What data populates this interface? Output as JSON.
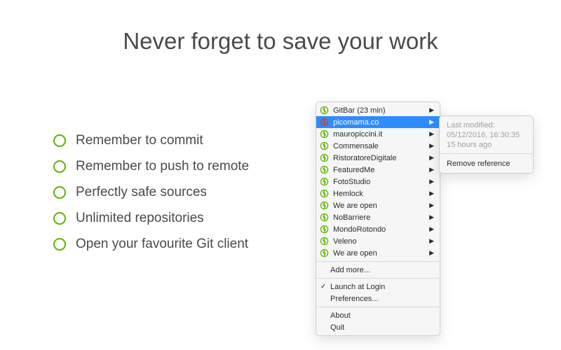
{
  "headline": "Never forget to save your work",
  "features": [
    "Remember to commit",
    "Remember to push to remote",
    "Perfectly safe sources",
    "Unlimited repositories",
    "Open your favourite Git client"
  ],
  "menu": {
    "repos": [
      {
        "name": "GitBar (23 min)",
        "status": "green",
        "selected": false
      },
      {
        "name": "picomama.co",
        "status": "red",
        "selected": true
      },
      {
        "name": "mauropiccini.it",
        "status": "green",
        "selected": false
      },
      {
        "name": "Commensale",
        "status": "green",
        "selected": false
      },
      {
        "name": "RistoratoreDigitale",
        "status": "green",
        "selected": false
      },
      {
        "name": "FeaturedMe",
        "status": "green",
        "selected": false
      },
      {
        "name": "FotoStudio",
        "status": "green",
        "selected": false
      },
      {
        "name": "Hemlock",
        "status": "green",
        "selected": false
      },
      {
        "name": "We are open",
        "status": "green",
        "selected": false
      },
      {
        "name": "NoBarriere",
        "status": "green",
        "selected": false
      },
      {
        "name": "MondoRotondo",
        "status": "green",
        "selected": false
      },
      {
        "name": "Veleno",
        "status": "green",
        "selected": false
      },
      {
        "name": "We are open",
        "status": "green",
        "selected": false
      }
    ],
    "add_more": "Add more...",
    "launch_at_login": "Launch at Login",
    "preferences": "Preferences...",
    "about": "About",
    "quit": "Quit"
  },
  "submenu": {
    "last_modified_label": "Last modified:",
    "timestamp": "05/12/2016, 16:30:35",
    "relative": "15 hours ago",
    "remove": "Remove reference"
  },
  "icon_colors": {
    "green": "#5fb200",
    "red": "#d93b2b"
  }
}
